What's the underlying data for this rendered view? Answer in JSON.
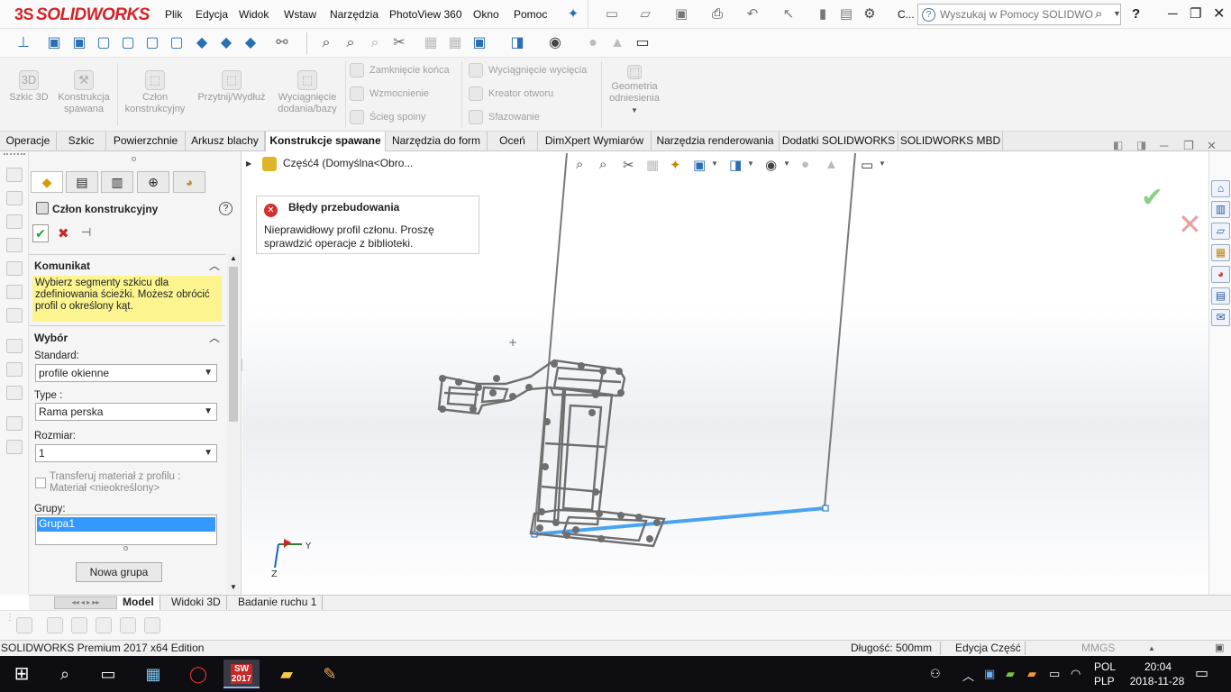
{
  "titlebar": {
    "logo": "SOLIDWORKS",
    "logo_mark": "3S",
    "menu": [
      "Plik",
      "Edycja",
      "Widok",
      "Wstaw",
      "Narzędzia",
      "PhotoView 360",
      "Okno",
      "Pomoc"
    ],
    "truncated_label": "C...",
    "search_placeholder": "Wyszukaj w Pomocy SOLIDWOR",
    "help": "?"
  },
  "command_manager": {
    "groups": [
      {
        "label": "Szkic 3D"
      },
      {
        "label": "Konstrukcja spawana"
      },
      {
        "label": "Człon konstrukcyjny"
      },
      {
        "label": "Przytnij/Wydłuż"
      },
      {
        "label": "Wyciągnięcie dodania/bazy"
      }
    ],
    "small_col1": [
      "Zamknięcie końca",
      "Wzmocnienie",
      "Ścieg spoiny"
    ],
    "small_col2": [
      "Wyciągnięcie wycięcia",
      "Kreator otworu",
      "Sfazowanie"
    ],
    "ref_geometry": "Geometria odniesienia"
  },
  "tabs": [
    "Operacje",
    "Szkic",
    "Powierzchnie",
    "Arkusz blachy",
    "Konstrukcje spawane",
    "Narzędzia do form",
    "Oceń",
    "DimXpert Wymiarów",
    "Narzędzia renderowania",
    "Dodatki SOLIDWORKS",
    "SOLIDWORKS MBD"
  ],
  "active_tab": "Konstrukcje spawane",
  "property_manager": {
    "title": "Człon konstrukcyjny",
    "help": "?",
    "message_section": {
      "title": "Komunikat",
      "text": "Wybierz segmenty szkicu dla zdefiniowania ścieżki. Możesz obrócić profil o określony kąt."
    },
    "selection_section": {
      "title": "Wybór",
      "standard_label": "Standard:",
      "standard_value": "profile okienne",
      "type_label": "Type :",
      "type_value": "Rama perska",
      "size_label": "Rozmiar:",
      "size_value": "1",
      "transfer_label": "Transferuj materiał z profilu :",
      "transfer_material": "Materiał <nieokreślony>",
      "transfer_checked": false,
      "groups_label": "Grupy:",
      "groups": [
        "Grupa1"
      ],
      "new_group_button": "Nowa grupa"
    }
  },
  "viewport": {
    "feature_tree_item": "Część4  (Domyślna<Obro...",
    "error_panel": {
      "title": "Błędy przebudowania",
      "text": "Nieprawidłowy profil członu. Proszę sprawdzić operacje z biblioteki."
    },
    "triad": {
      "x": "",
      "y": "Y",
      "z": "Z"
    }
  },
  "bottom_tabs": [
    "Model",
    "Widoki 3D",
    "Badanie ruchu 1"
  ],
  "active_bottom_tab": "Model",
  "statusbar": {
    "edition": "SOLIDWORKS Premium 2017 x64 Edition",
    "length": "Długość: 500mm",
    "mode": "Edycja Część",
    "units": "MMGS"
  },
  "taskbar": {
    "lang_top": "POL",
    "lang_bottom": "PLP",
    "time": "20:04",
    "date": "2018-11-28",
    "sw_badge": "2017"
  },
  "colors": {
    "brand_red": "#d4232a",
    "selection_blue": "#3399ff",
    "message_yellow": "#fbf48f",
    "sketch_line_blue": "#4aa3f0"
  }
}
